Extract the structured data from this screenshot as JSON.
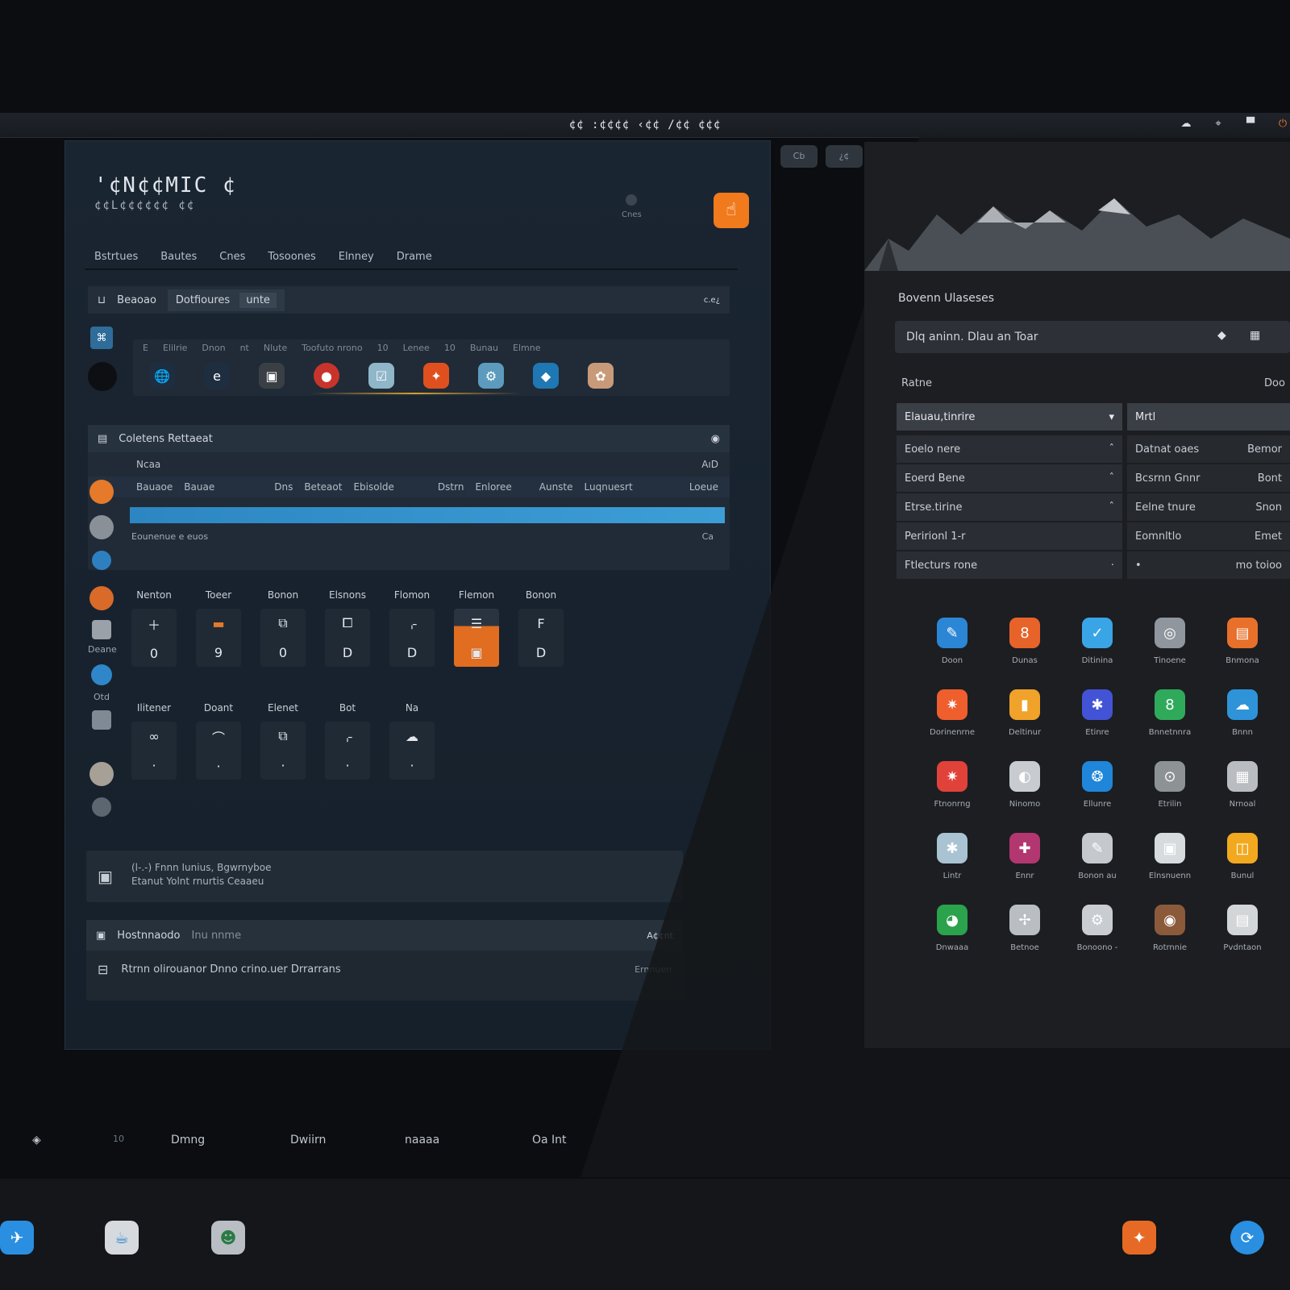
{
  "topbar": {
    "clock": "¢¢ :¢¢¢¢ ‹¢¢ /¢¢  ¢¢¢",
    "tray_icons": [
      "network-icon",
      "pin-icon",
      "chat-icon",
      "power-icon"
    ]
  },
  "tabs": [
    "Cb",
    "¿¢"
  ],
  "left": {
    "brand_line1": "'¢N¢¢MIC ¢",
    "brand_line2": "¢¢L¢¢¢¢¢¢ ¢¢",
    "status_label": "Cnes",
    "menu": [
      "Bstrtues",
      "Bautes",
      "Cnes",
      "Tosoones",
      "Elnney",
      "Drame"
    ],
    "toolbar": {
      "label1": "Beaoao",
      "label2": "Dotfioures",
      "chip": "unte",
      "right": "c.e¿"
    },
    "row_text": [
      "E",
      "Elilrie",
      "Dnon",
      "nt",
      "Nlute",
      "Toofuto nrono",
      "10",
      "Lenee",
      "10",
      "Bunau",
      "Elmne"
    ],
    "apps_row": [
      "globe-icon",
      "edge-icon",
      "archive-icon",
      "red-app-icon",
      "checkbox-icon",
      "fire-app-icon",
      "settings-app-icon",
      "blue-app-icon",
      "photo-app-icon"
    ],
    "section": {
      "title": "Coletens Rettaeat",
      "sub_left": "Ncaa",
      "sub_right": "AıD",
      "cols": [
        "Bauaoe",
        "Bauae",
        "Dns",
        "Beteaot",
        "Ebisolde",
        "Dstrn",
        "Enloree",
        "Aunste",
        "Luqnuesrt",
        "Loeue"
      ],
      "progress": 100,
      "foot_left": "Eounenue e euos",
      "foot_right": "Ca"
    },
    "tiles1": {
      "labels": [
        "Nenton",
        "Toeer",
        "Bonon",
        "Elsnons",
        "Flomon",
        "Flemon",
        "Bonon"
      ],
      "values": [
        "0",
        "9",
        "0",
        "D",
        "D",
        "",
        "D"
      ]
    },
    "tiles2": {
      "labels": [
        "Ilitener",
        "Doant",
        "Elenet",
        "Bot",
        "Na"
      ]
    },
    "sidebar_label1": "Deane",
    "sidebar_label2": "Otd",
    "notice": {
      "line1": "(l-.-) Fnnn Iunius, Bgwrnyboe",
      "line2": "Etanut Yolnt rnurtis Ceaaeu"
    },
    "bottom_panel": {
      "title": "Hostnnaodo",
      "subtitle": "Inu nnme",
      "right": "A¢¢nt",
      "line": "Rtrnn olirouanor Dnno crino.uer Drrarrans",
      "line_right": "Ernnuen"
    }
  },
  "right": {
    "title": "Bovenn Ulaseses",
    "search": "Dlq aninn. Dlau an Toar",
    "section_left": "Ratne",
    "section_right": "Doo",
    "rows": [
      {
        "a": "Elauau,tinrire",
        "b": "Mrtl",
        "c": "",
        "hdr": true
      },
      {
        "a": "Eoelo nere",
        "b": "Datnat oaes",
        "c": "Bemor"
      },
      {
        "a": "Eoerd Bene",
        "b": "Bcsrnn Gnnr",
        "c": "Bont"
      },
      {
        "a": "Etrse.tirine",
        "b": "Eelne tnure",
        "c": "Snon"
      },
      {
        "a": "Peririonl 1-r",
        "b": "Eomnltlo",
        "c": "Emet"
      },
      {
        "a": "Ftlecturs rone",
        "b": "•",
        "c": "mo toioo"
      }
    ],
    "apps": [
      "Doon",
      "Dunas",
      "Ditinina",
      "Tinoene",
      "Bnmona",
      "Dorinenrne",
      "Deltinur",
      "Etinre",
      "Bnnetnnra",
      "Bnnn",
      "Ftnonrng",
      "Ninomo",
      "Ellunre",
      "Etrilin",
      "Nrnoal",
      "Lintr",
      "Ennr",
      "Bonon au",
      "Elnsnuenn",
      "Bunul",
      "Dnwaaa",
      "Betnoe",
      "Bonoono -",
      "Rotrnnie",
      "Pvdntaon"
    ]
  },
  "statusline": [
    "10",
    "Dmng",
    "Dwiirn",
    "naaaa",
    "Oa Int"
  ]
}
